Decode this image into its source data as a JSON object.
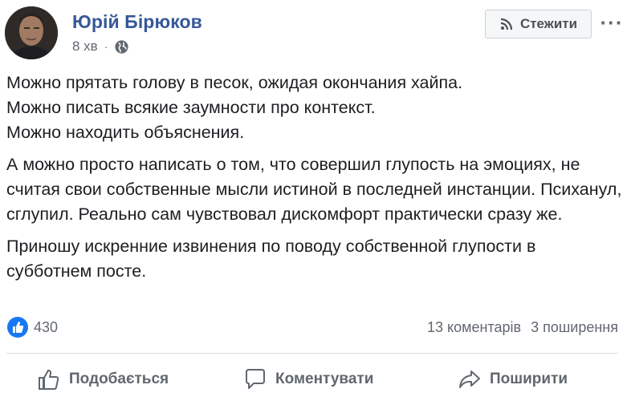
{
  "post": {
    "author": "Юрій Бірюков",
    "time": "8 хв",
    "separator": "·",
    "follow_label": "Стежити",
    "more_label": "···",
    "paragraphs": [
      [
        "Можно прятать голову в песок, ожидая окончания хайпа.",
        "Можно писать всякие заумности про контекст.",
        "Можно находить объяснения."
      ],
      [
        "А можно просто написать о том, что совершил глупость на эмоциях, не считая свои собственные мысли истиной в последней инстанции. Психанул, сглупил. Реально сам чувствовал дискомфорт практически сразу же."
      ],
      [
        "Приношу искренние извинения по поводу собственной глупости в субботнем посте."
      ]
    ],
    "reactions_count": "430",
    "comments_count": "13 коментарів",
    "shares_count": "3 поширення",
    "actions": {
      "like": "Подобається",
      "comment": "Коментувати",
      "share": "Поширити"
    },
    "colors": {
      "author": "#365899",
      "meta": "#616770",
      "like_blue": "#1877f2"
    },
    "icons": [
      "globe-icon",
      "rss-icon",
      "more-icon",
      "like-reaction-icon",
      "thumbs-up-icon",
      "comment-icon",
      "share-icon"
    ]
  }
}
